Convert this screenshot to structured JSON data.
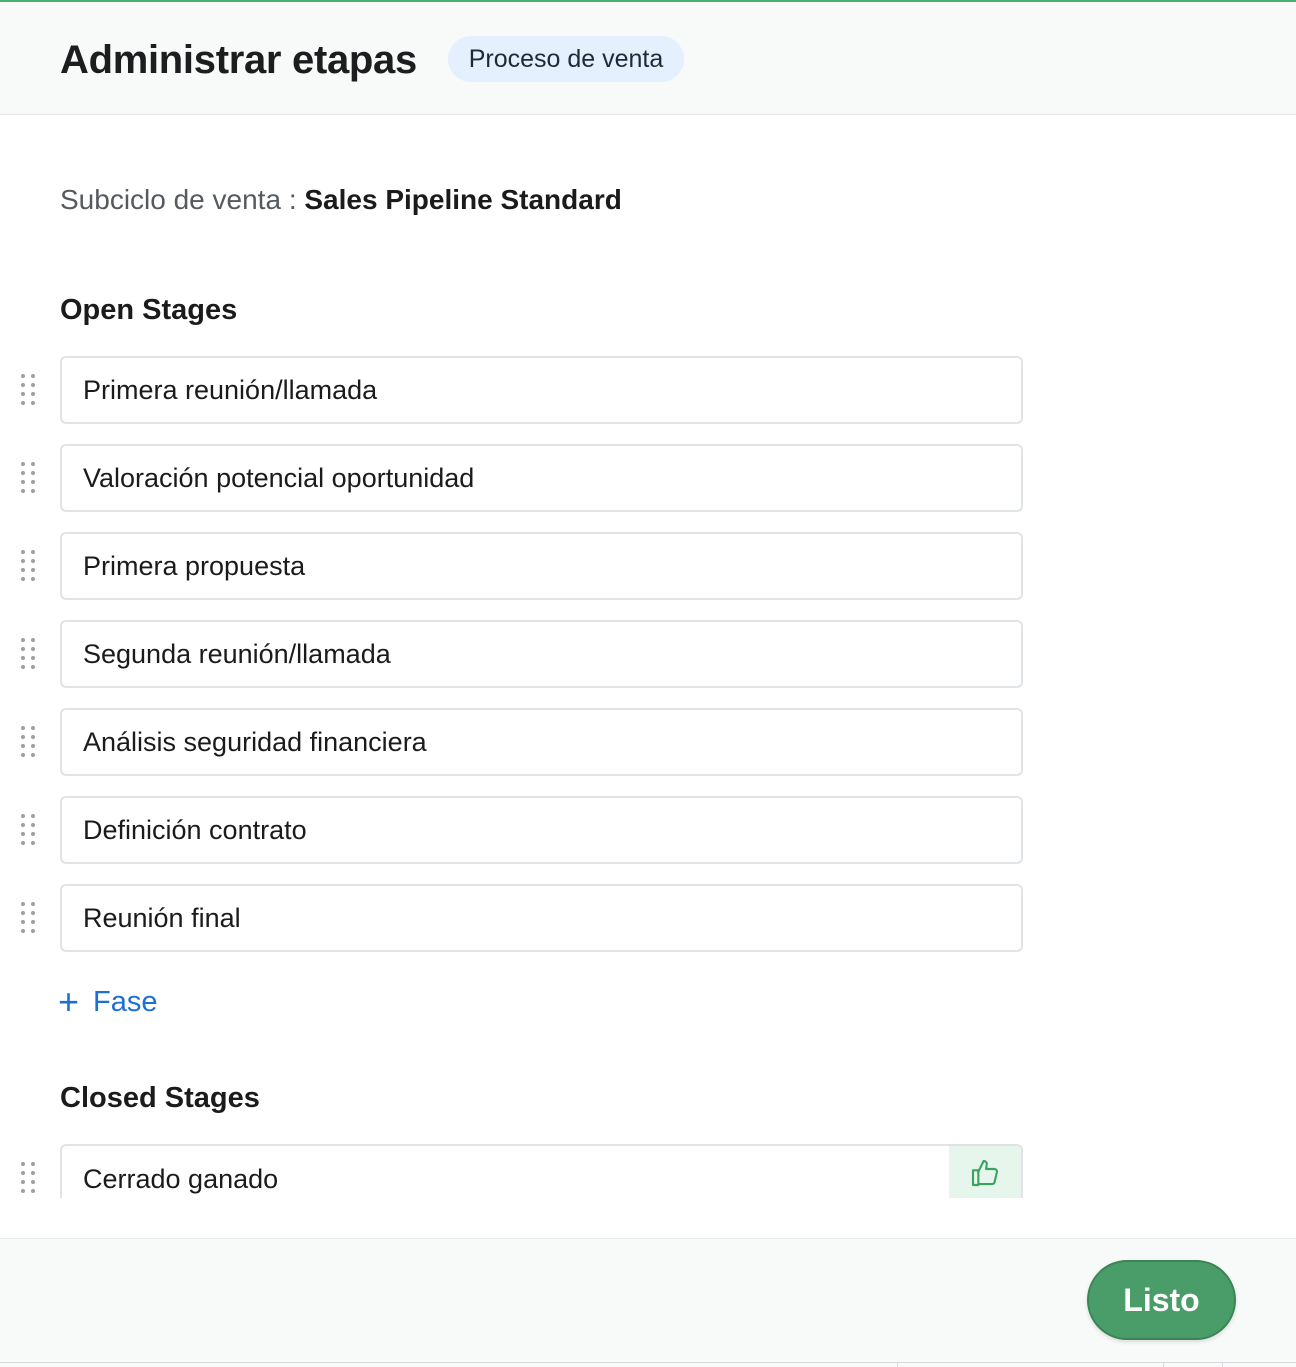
{
  "header": {
    "title": "Administrar etapas",
    "badge": "Proceso de venta"
  },
  "subcycle": {
    "label": "Subciclo de venta :",
    "value": "Sales Pipeline Standard"
  },
  "open_stages": {
    "title": "Open Stages",
    "items": [
      {
        "label": "Primera reunión/llamada"
      },
      {
        "label": "Valoración potencial oportunidad"
      },
      {
        "label": "Primera propuesta"
      },
      {
        "label": "Segunda reunión/llamada"
      },
      {
        "label": "Análisis seguridad financiera"
      },
      {
        "label": "Definición contrato"
      },
      {
        "label": "Reunión final"
      }
    ],
    "add_label": "Fase"
  },
  "closed_stages": {
    "title": "Closed Stages",
    "items": [
      {
        "label": "Cerrado ganado",
        "icon": "thumbs-up-icon"
      }
    ]
  },
  "footer": {
    "done_label": "Listo"
  },
  "colors": {
    "accent_green": "#4a9d68",
    "link_blue": "#1d6fd1",
    "badge_bg": "#e4f0fd"
  }
}
